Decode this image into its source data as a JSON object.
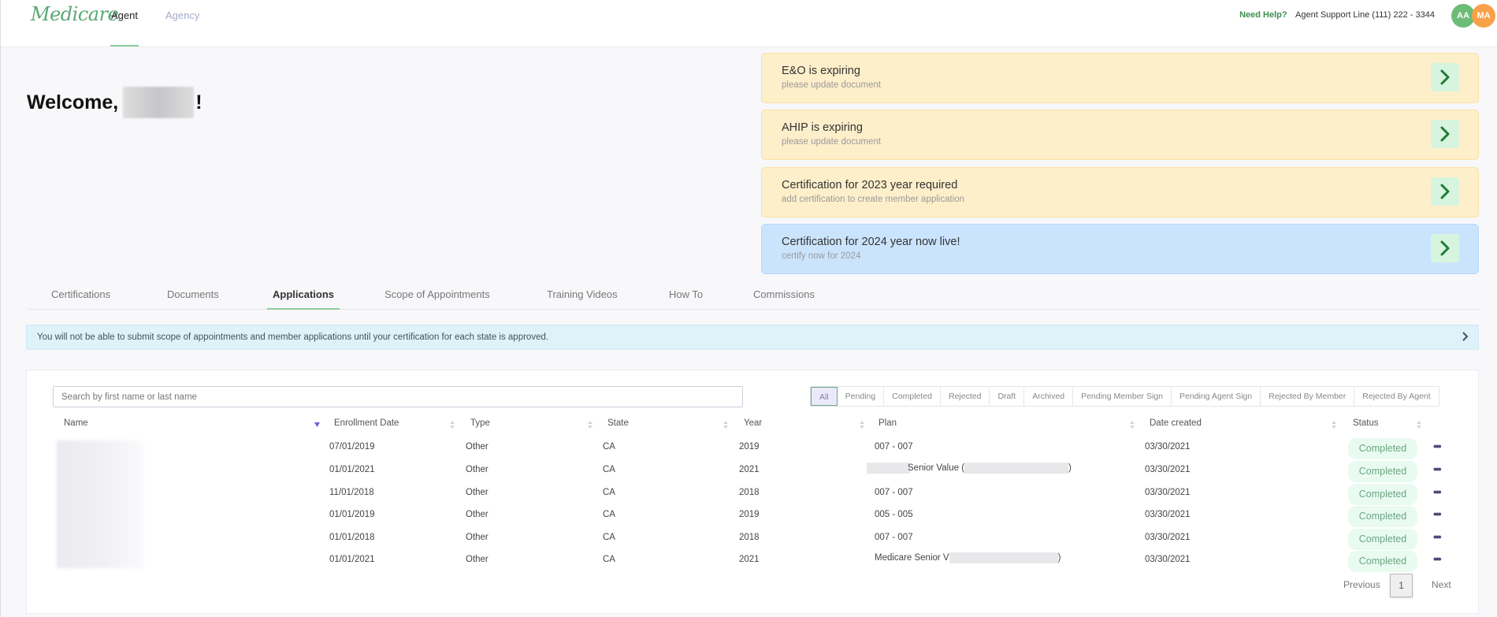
{
  "header": {
    "logo": "Medicare",
    "nav": [
      {
        "label": "Agent",
        "active": true
      },
      {
        "label": "Agency",
        "active": false
      }
    ],
    "help_label": "Need Help?",
    "support_line": "Agent Support Line (111) 222 - 3344",
    "avatars": [
      {
        "initials": "AA",
        "color": "#6dbb78"
      },
      {
        "initials": "MA",
        "color": "#f7a149"
      }
    ]
  },
  "welcome": {
    "prefix": "Welcome,",
    "suffix": "!"
  },
  "alerts": [
    {
      "title": "E&O is expiring",
      "subtitle": "please update document",
      "kind": "warning",
      "icon": "chevron-right-icon"
    },
    {
      "title": "AHIP is expiring",
      "subtitle": "please update document",
      "kind": "warning",
      "icon": "chevron-right-icon"
    },
    {
      "title": "Certification for 2023 year required",
      "subtitle": "add certification to create member application",
      "kind": "warning",
      "icon": "chevron-right-icon"
    },
    {
      "title": "Certification for 2024 year now live!",
      "subtitle": "certify now for 2024",
      "kind": "info",
      "icon": "chevron-right-icon"
    }
  ],
  "tabs": [
    {
      "label": "Certifications",
      "active": false
    },
    {
      "label": "Documents",
      "active": false
    },
    {
      "label": "Applications",
      "active": true
    },
    {
      "label": "Scope of Appointments",
      "active": false
    },
    {
      "label": "Training Videos",
      "active": false
    },
    {
      "label": "How To",
      "active": false
    },
    {
      "label": "Commissions",
      "active": false
    }
  ],
  "banner": {
    "text": "You will not be able to submit scope of appointments and member applications until your certification for each state is approved."
  },
  "applications": {
    "search": {
      "placeholder": "Search by first name or last name",
      "value": ""
    },
    "filters": [
      "All",
      "Pending",
      "Completed",
      "Rejected",
      "Draft",
      "Archived",
      "Pending Member Sign",
      "Pending Agent Sign",
      "Rejected By Member",
      "Rejected By Agent"
    ],
    "active_filter": "All",
    "columns": [
      "Name",
      "Enrollment Date",
      "Type",
      "State",
      "Year",
      "Plan",
      "Date created",
      "Status"
    ],
    "rows": [
      {
        "enrollment_date": "07/01/2019",
        "type": "Other",
        "state": "CA",
        "year": "2019",
        "plan_pre": "007 - 007",
        "plan_post": "",
        "date_created": "03/30/2021",
        "status": "Completed"
      },
      {
        "enrollment_date": "01/01/2021",
        "type": "Other",
        "state": "CA",
        "year": "2021",
        "plan_pre": "Senior Value (",
        "plan_post": ")",
        "date_created": "03/30/2021",
        "status": "Completed"
      },
      {
        "enrollment_date": "11/01/2018",
        "type": "Other",
        "state": "CA",
        "year": "2018",
        "plan_pre": "007 - 007",
        "plan_post": "",
        "date_created": "03/30/2021",
        "status": "Completed"
      },
      {
        "enrollment_date": "01/01/2019",
        "type": "Other",
        "state": "CA",
        "year": "2019",
        "plan_pre": "005 - 005",
        "plan_post": "",
        "date_created": "03/30/2021",
        "status": "Completed"
      },
      {
        "enrollment_date": "01/01/2018",
        "type": "Other",
        "state": "CA",
        "year": "2018",
        "plan_pre": "007 - 007",
        "plan_post": "",
        "date_created": "03/30/2021",
        "status": "Completed"
      },
      {
        "enrollment_date": "01/01/2021",
        "type": "Other",
        "state": "CA",
        "year": "2021",
        "plan_pre": "Medicare Senior V",
        "plan_post": ")",
        "date_created": "03/30/2021",
        "status": "Completed"
      }
    ],
    "row_action_icon": "more-horizontal-icon",
    "pagination": {
      "previous": "Previous",
      "page": "1",
      "next": "Next"
    }
  }
}
